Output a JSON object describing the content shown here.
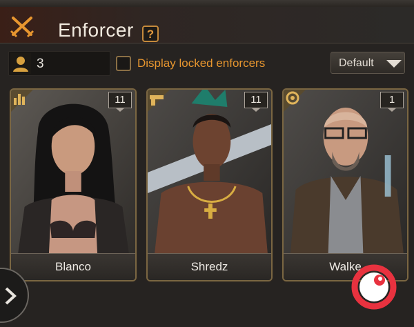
{
  "header": {
    "title": "Enforcer",
    "help_label": "?"
  },
  "toolbar": {
    "count_value": "3",
    "display_locked_label": "Display locked enforcers",
    "display_locked_checked": false,
    "sort_label": "Default"
  },
  "cards": [
    {
      "name": "Blanco",
      "level": "11",
      "role_icon": "stats-bar-icon"
    },
    {
      "name": "Shredz",
      "level": "11",
      "role_icon": "pistol-icon"
    },
    {
      "name": "Walke",
      "level": "1",
      "role_icon": "head-gear-icon"
    }
  ],
  "colors": {
    "accent_orange": "#e7962f",
    "card_border": "#7a6642",
    "logo_red": "#e8323f"
  }
}
